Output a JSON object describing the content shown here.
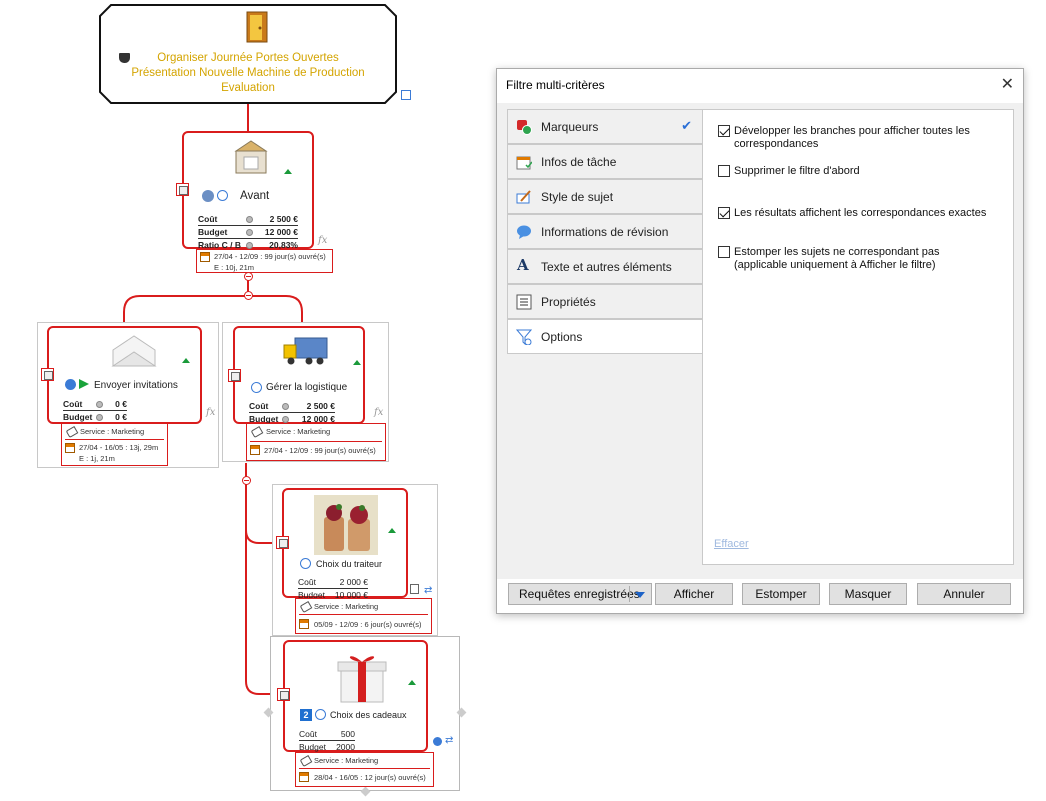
{
  "map": {
    "central": {
      "lines": [
        "Organiser Journée Portes Ouvertes",
        "Présentation Nouvelle Machine de Production",
        "Evaluation"
      ],
      "icon": "door-icon"
    },
    "avant": {
      "label": "Avant",
      "props": [
        {
          "key": "Coût",
          "value": "2 500 €"
        },
        {
          "key": "Budget",
          "value": "12 000 €"
        },
        {
          "key": "Ratio C / B",
          "value": "20,83%"
        }
      ],
      "dates": "27/04 - 12/09 : 99 jour(s) ouvré(s)",
      "effort": "E : 10j, 21m"
    },
    "invitations": {
      "label": "Envoyer invitations",
      "props": [
        {
          "key": "Coût",
          "value": "0 €"
        },
        {
          "key": "Budget",
          "value": "0 €"
        }
      ],
      "service": "Service : Marketing",
      "dates": "27/04 - 16/05 : 13j, 29m",
      "effort": "E : 1j, 21m"
    },
    "logistique": {
      "label": "Gérer la logistique",
      "props": [
        {
          "key": "Coût",
          "value": "2 500 €"
        },
        {
          "key": "Budget",
          "value": "12 000 €"
        }
      ],
      "service": "Service : Marketing",
      "dates": "27/04 - 12/09 : 99 jour(s) ouvré(s)"
    },
    "traiteur": {
      "label": "Choix du traiteur",
      "props": [
        {
          "key": "Coût",
          "value": "2 000 €"
        },
        {
          "key": "Budget",
          "value": "10 000 €"
        }
      ],
      "service": "Service : Marketing",
      "dates": "05/09 - 12/09 : 6 jour(s) ouvré(s)"
    },
    "cadeaux": {
      "label": "Choix des cadeaux",
      "priority": "2",
      "props": [
        {
          "key": "Coût",
          "value": "500"
        },
        {
          "key": "Budget",
          "value": "2000"
        }
      ],
      "service": "Service : Marketing",
      "dates": "28/04 - 16/05 : 12 jour(s) ouvré(s)"
    },
    "fx": "fx"
  },
  "dialog": {
    "title": "Filtre multi-critères",
    "close": "✕",
    "nav": [
      {
        "label": "Marqueurs",
        "icon": "markers-icon",
        "checked": true
      },
      {
        "label": "Infos de tâche",
        "icon": "task-info-icon"
      },
      {
        "label": "Style de sujet",
        "icon": "topic-style-icon"
      },
      {
        "label": "Informations de révision",
        "icon": "review-info-icon"
      },
      {
        "label": "Texte et autres éléments",
        "icon": "text-icon"
      },
      {
        "label": "Propriétés",
        "icon": "properties-icon"
      },
      {
        "label": "Options",
        "icon": "filter-options-icon",
        "selected": true
      }
    ],
    "check_mark": "✔",
    "options": [
      {
        "text": "Développer les branches pour afficher toutes les correspondances",
        "checked": true
      },
      {
        "text": "Supprimer le filtre d'abord",
        "checked": false
      },
      {
        "text": "Les résultats affichent les correspondances exactes",
        "checked": true
      },
      {
        "text": "Estomper les sujets ne correspondant pas (applicable uniquement à Afficher le filtre)",
        "checked": false
      }
    ],
    "effacer": "Effacer",
    "buttons": {
      "saved_queries": "Requêtes enregistrées",
      "afficher": "Afficher",
      "estomper": "Estomper",
      "masquer": "Masquer",
      "annuler": "Annuler"
    },
    "accent": "#1c62c7"
  }
}
